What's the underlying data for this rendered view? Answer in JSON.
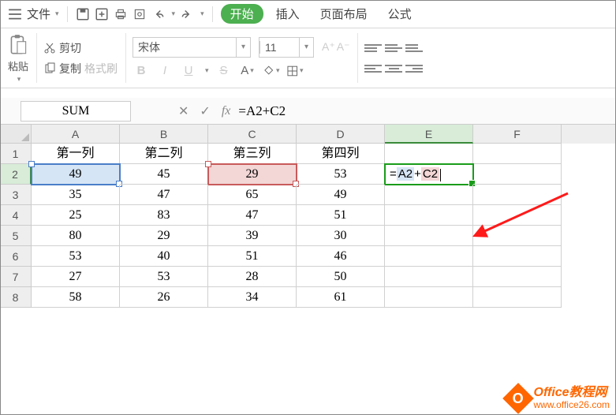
{
  "menu": {
    "file": "文件",
    "tabs": {
      "start": "开始",
      "insert": "插入",
      "layout": "页面布局",
      "formula": "公式"
    }
  },
  "ribbon": {
    "paste": "粘贴",
    "cut": "剪切",
    "copy": "复制",
    "format_painter": "格式刷",
    "font_name": "宋体",
    "font_size": "11",
    "bold": "B",
    "italic": "I",
    "underline": "U",
    "strike": "S",
    "inc_font": "A⁺",
    "dec_font": "A⁻"
  },
  "formula_bar": {
    "name_box": "SUM",
    "cancel": "✕",
    "confirm": "✓",
    "fx": "fx",
    "formula": "=A2+C2"
  },
  "sheet": {
    "columns": [
      "A",
      "B",
      "C",
      "D",
      "E",
      "F"
    ],
    "headers": [
      "第一列",
      "第二列",
      "第三列",
      "第四列"
    ],
    "rows": [
      {
        "n": "2",
        "A": "49",
        "B": "45",
        "C": "29",
        "D": "53"
      },
      {
        "n": "3",
        "A": "35",
        "B": "47",
        "C": "65",
        "D": "49"
      },
      {
        "n": "4",
        "A": "25",
        "B": "83",
        "C": "47",
        "D": "51"
      },
      {
        "n": "5",
        "A": "80",
        "B": "29",
        "C": "39",
        "D": "30"
      },
      {
        "n": "6",
        "A": "53",
        "B": "40",
        "C": "51",
        "D": "46"
      },
      {
        "n": "7",
        "A": "27",
        "B": "53",
        "C": "28",
        "D": "50"
      },
      {
        "n": "8",
        "A": "58",
        "B": "26",
        "C": "34",
        "D": "61"
      }
    ],
    "active_cell": "E2",
    "active_formula_eq": "=",
    "active_formula_a": "A2",
    "active_formula_plus": "+",
    "active_formula_c": "C2"
  },
  "watermark": {
    "title": "Office教程网",
    "url": "www.office26.com",
    "logo": "O"
  }
}
